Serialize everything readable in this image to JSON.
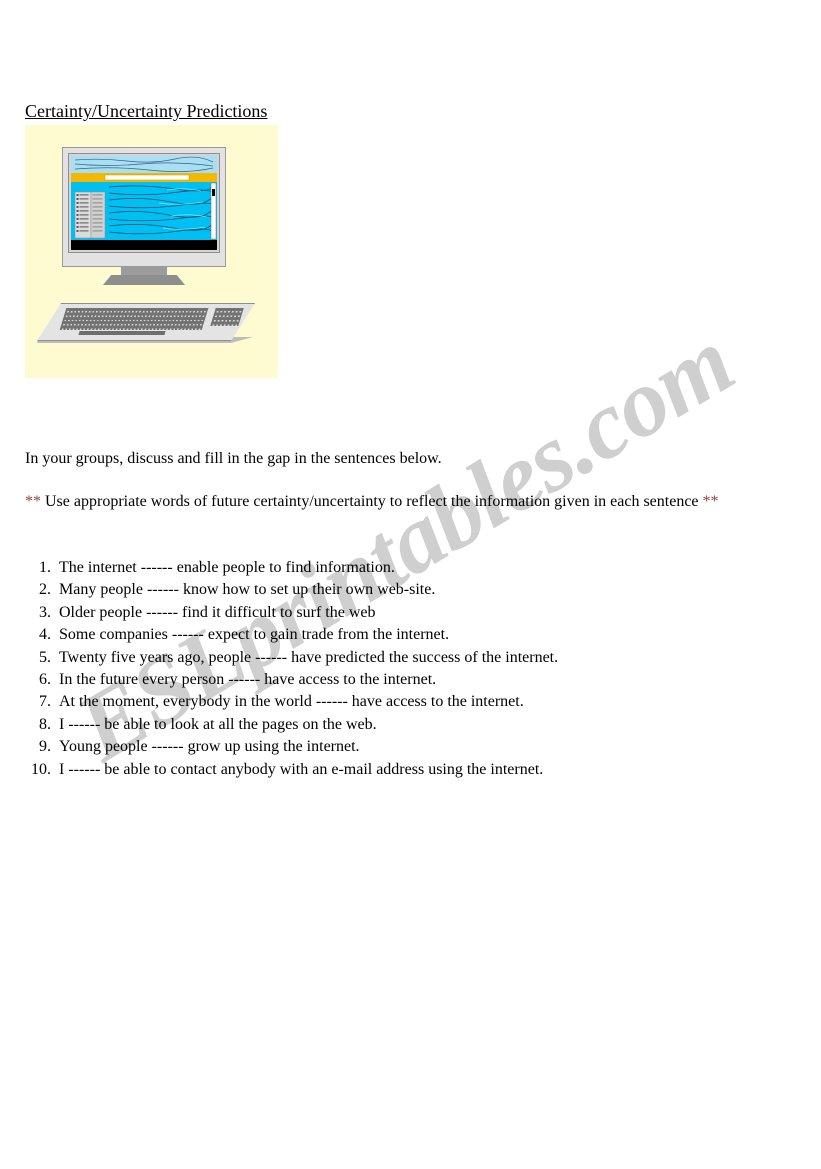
{
  "document": {
    "title": "Certainty/Uncertainty Predictions",
    "intro": "In your groups, discuss and fill in the gap in the sentences below.",
    "instruction": {
      "leading_marks": "**",
      "text": "Use appropriate words of future certainty/uncertainty to reflect the information given in each sentence",
      "trailing_marks": "**"
    },
    "sentences": [
      {
        "number": "1.",
        "text": "The internet ------ enable people to find information."
      },
      {
        "number": "2.",
        "text": "Many people ------ know how to set up their own web-site."
      },
      {
        "number": "3.",
        "text": "Older people ------ find it difficult to surf the web"
      },
      {
        "number": "4.",
        "text": "Some companies ------ expect to gain trade from the internet."
      },
      {
        "number": "5.",
        "text": "Twenty five years ago, people ------ have predicted the success of the internet."
      },
      {
        "number": "6.",
        "text": "In the future every person ------ have access to the internet."
      },
      {
        "number": "7.",
        "text": "At the moment, everybody in the world ------ have access to the internet."
      },
      {
        "number": "8.",
        "text": "I ------ be able to look at all the pages on the web."
      },
      {
        "number": "9.",
        "text": "Young people ------ grow up using the internet."
      },
      {
        "number": "10.",
        "text": "I ------ be able to contact anybody with an e-mail address using the internet."
      }
    ]
  },
  "clipart": {
    "alt": "desktop computer with monitor and keyboard",
    "background_color": "#fdfbcf",
    "screen_color": "#00bff3",
    "address_bar_color": "#f5b800",
    "bezel_color": "#e2e2e2"
  },
  "watermark": {
    "text": "ESLprintables.com",
    "color": "#cfcfcf"
  }
}
